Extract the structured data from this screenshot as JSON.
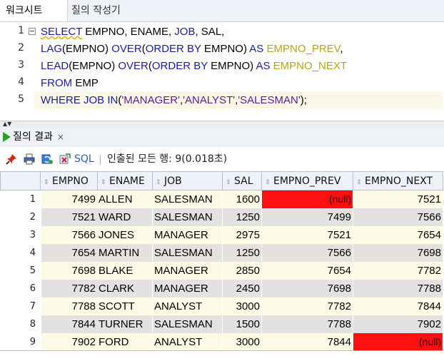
{
  "tabs": {
    "worksheet": "워크시트",
    "query_builder": "질의 작성기"
  },
  "editor": {
    "line_numbers": [
      "1",
      "2",
      "3",
      "4",
      "5"
    ],
    "lines": [
      [
        {
          "t": "SELECT",
          "c": "kw sq"
        },
        {
          "t": " EMPNO, ENAME, ",
          "c": "plain"
        },
        {
          "t": "JOB",
          "c": "kw"
        },
        {
          "t": ", SAL,",
          "c": "plain"
        }
      ],
      [
        {
          "t": "LAG",
          "c": "kw"
        },
        {
          "t": "(EMPNO) ",
          "c": "plain"
        },
        {
          "t": "OVER",
          "c": "kw"
        },
        {
          "t": "(",
          "c": "plain"
        },
        {
          "t": "ORDER BY",
          "c": "kw"
        },
        {
          "t": " EMPNO) ",
          "c": "plain"
        },
        {
          "t": "AS",
          "c": "kw"
        },
        {
          "t": " ",
          "c": "plain"
        },
        {
          "t": "EMPNO_PREV",
          "c": "ident"
        },
        {
          "t": ",",
          "c": "plain"
        }
      ],
      [
        {
          "t": "LEAD",
          "c": "kw"
        },
        {
          "t": "(EMPNO) ",
          "c": "plain"
        },
        {
          "t": "OVER",
          "c": "kw"
        },
        {
          "t": "(",
          "c": "plain"
        },
        {
          "t": "ORDER BY",
          "c": "kw"
        },
        {
          "t": " EMPNO) ",
          "c": "plain"
        },
        {
          "t": "AS",
          "c": "kw"
        },
        {
          "t": " ",
          "c": "plain"
        },
        {
          "t": "EMPNO_NEXT",
          "c": "ident"
        }
      ],
      [
        {
          "t": "FROM",
          "c": "kw"
        },
        {
          "t": " EMP",
          "c": "plain"
        }
      ],
      [
        {
          "t": "WHERE",
          "c": "kw"
        },
        {
          "t": " ",
          "c": "plain"
        },
        {
          "t": "JOB",
          "c": "kw"
        },
        {
          "t": " ",
          "c": "plain"
        },
        {
          "t": "IN",
          "c": "kw"
        },
        {
          "t": "(",
          "c": "plain"
        },
        {
          "t": "'MANAGER'",
          "c": "str"
        },
        {
          "t": ",",
          "c": "plain"
        },
        {
          "t": "'ANALYST'",
          "c": "str"
        },
        {
          "t": ",",
          "c": "plain"
        },
        {
          "t": "'SALESMAN'",
          "c": "str"
        },
        {
          "t": ");",
          "c": "plain"
        }
      ]
    ]
  },
  "results_tab": {
    "label": "질의 결과",
    "close": "×"
  },
  "toolbar": {
    "sql_label": "SQL",
    "status": "인출된 모든 행: 9(0.018초)"
  },
  "grid": {
    "columns": [
      "EMPNO",
      "ENAME",
      "JOB",
      "SAL",
      "EMPNO_PREV",
      "EMPNO_NEXT"
    ],
    "rows": [
      {
        "n": "1",
        "EMPNO": "7499",
        "ENAME": "ALLEN",
        "JOB": "SALESMAN",
        "SAL": "1600",
        "EMPNO_PREV": "(null)",
        "EMPNO_NEXT": "7521"
      },
      {
        "n": "2",
        "EMPNO": "7521",
        "ENAME": "WARD",
        "JOB": "SALESMAN",
        "SAL": "1250",
        "EMPNO_PREV": "7499",
        "EMPNO_NEXT": "7566"
      },
      {
        "n": "3",
        "EMPNO": "7566",
        "ENAME": "JONES",
        "JOB": "MANAGER",
        "SAL": "2975",
        "EMPNO_PREV": "7521",
        "EMPNO_NEXT": "7654"
      },
      {
        "n": "4",
        "EMPNO": "7654",
        "ENAME": "MARTIN",
        "JOB": "SALESMAN",
        "SAL": "1250",
        "EMPNO_PREV": "7566",
        "EMPNO_NEXT": "7698"
      },
      {
        "n": "5",
        "EMPNO": "7698",
        "ENAME": "BLAKE",
        "JOB": "MANAGER",
        "SAL": "2850",
        "EMPNO_PREV": "7654",
        "EMPNO_NEXT": "7782"
      },
      {
        "n": "6",
        "EMPNO": "7782",
        "ENAME": "CLARK",
        "JOB": "MANAGER",
        "SAL": "2450",
        "EMPNO_PREV": "7698",
        "EMPNO_NEXT": "7788"
      },
      {
        "n": "7",
        "EMPNO": "7788",
        "ENAME": "SCOTT",
        "JOB": "ANALYST",
        "SAL": "3000",
        "EMPNO_PREV": "7782",
        "EMPNO_NEXT": "7844"
      },
      {
        "n": "8",
        "EMPNO": "7844",
        "ENAME": "TURNER",
        "JOB": "SALESMAN",
        "SAL": "1500",
        "EMPNO_PREV": "7788",
        "EMPNO_NEXT": "7902"
      },
      {
        "n": "9",
        "EMPNO": "7902",
        "ENAME": "FORD",
        "JOB": "ANALYST",
        "SAL": "3000",
        "EMPNO_PREV": "7844",
        "EMPNO_NEXT": "(null)"
      }
    ]
  },
  "colors": {
    "keyword": "#1a1aa6",
    "string": "#5a1a9a",
    "alias": "#b5a21a",
    "null_cell": "#ff1010",
    "row_odd": "#fdfbe6",
    "row_even": "#e4e1e1"
  }
}
